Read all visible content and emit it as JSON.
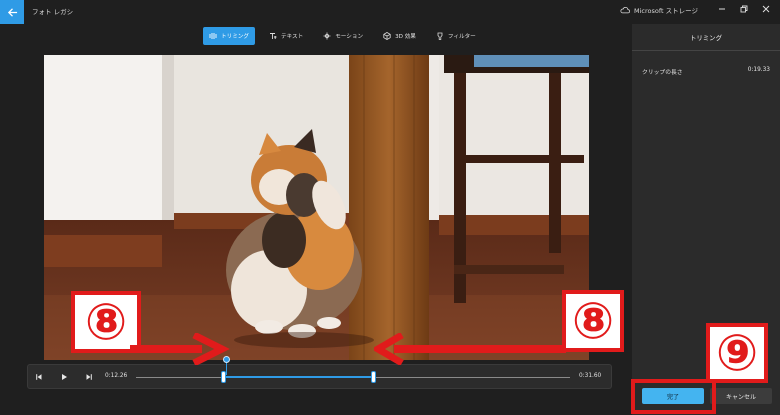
{
  "app": {
    "title": "フォト レガシ",
    "store_label": "Microsoft ストレージ"
  },
  "toolbar": {
    "items": [
      {
        "label": "トリミング",
        "icon": "trim-icon",
        "active": true
      },
      {
        "label": "テキスト",
        "icon": "text-icon",
        "active": false
      },
      {
        "label": "モーション",
        "icon": "motion-icon",
        "active": false
      },
      {
        "label": "3D 効果",
        "icon": "3d-effects-icon",
        "active": false
      },
      {
        "label": "フィルター",
        "icon": "filter-icon",
        "active": false
      }
    ]
  },
  "panel": {
    "title": "トリミング",
    "clip_length_label": "クリップの長さ",
    "clip_length_value": "0:19.33"
  },
  "playback": {
    "start_time": "0:12.26",
    "end_time": "0:31.60",
    "selection_start_fraction": 0.2,
    "selection_end_fraction": 0.55
  },
  "actions": {
    "done_label": "完了",
    "cancel_label": "キャンセル"
  },
  "annotations": {
    "step8_label": "⑧",
    "step9_label": "⑨"
  },
  "colors": {
    "accent": "#2f9be6",
    "done_button": "#44b4f0",
    "annotation_red": "#e11b1b"
  }
}
